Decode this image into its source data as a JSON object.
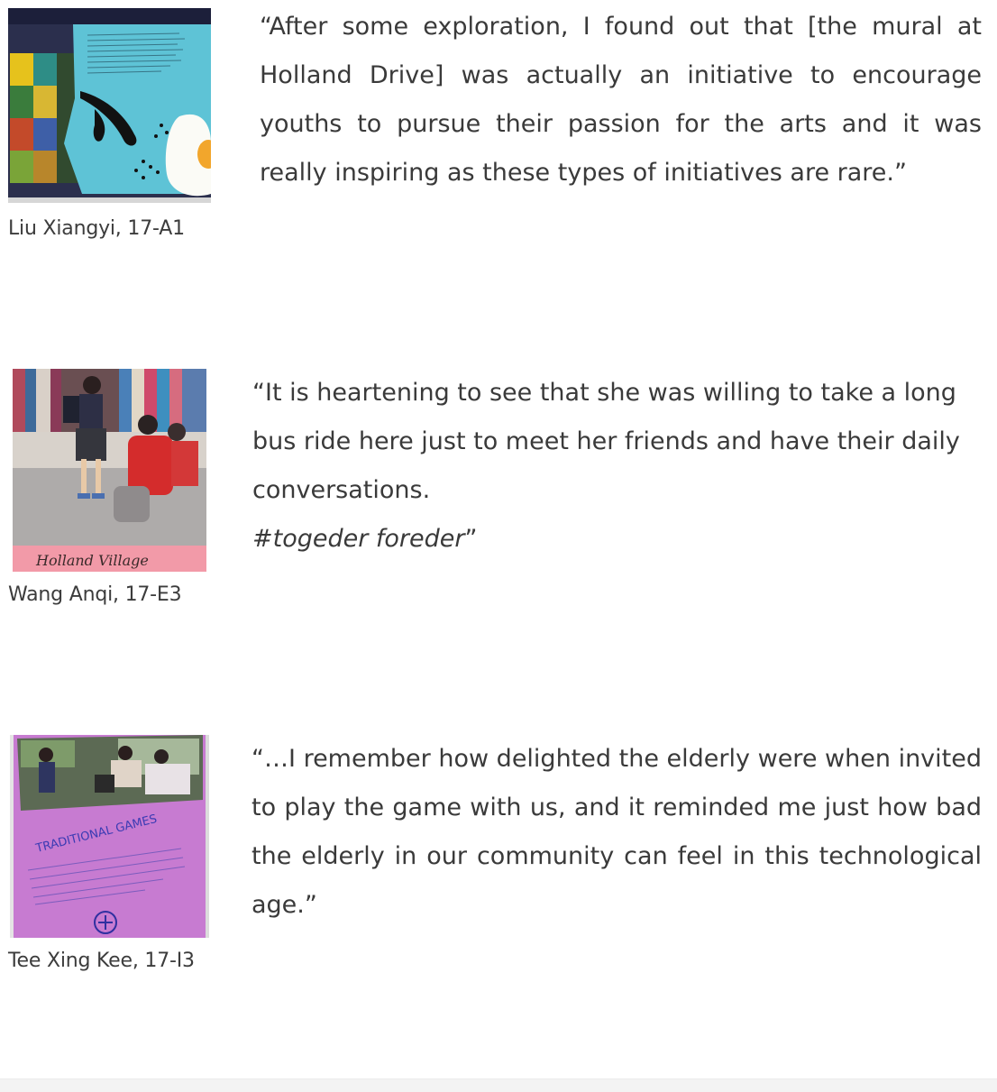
{
  "entries": [
    {
      "quote": "“After some exploration, I found out that [the mural at Holland Drive] was actually an initiative to encourage youths to pursue their passion for the arts and it was really inspiring as these types of initiatives are rare.”",
      "caption": "Liu Xiangyi, 17-A1",
      "photo_alt": "mural artwork photo"
    },
    {
      "quote_line": "“It is heartening to see that she was willing to take a long bus ride here just to meet her friends and have their daily conversations.",
      "hashtag": "#togeder foreder",
      "hashtag_close": "”",
      "caption": "Wang Anqi, 17-E3",
      "photo_alt": "Holland Village photo",
      "photo_text": "Holland Village"
    },
    {
      "quote": "“…I remember how delighted the elderly were when invited to play the game with us, and it reminded me just how bad the elderly in our community can feel in this technological age.”",
      "caption": "Tee Xing Kee, 17-I3",
      "photo_alt": "traditional games poster photo",
      "photo_text": "TRADITIONAL GAMES"
    }
  ]
}
